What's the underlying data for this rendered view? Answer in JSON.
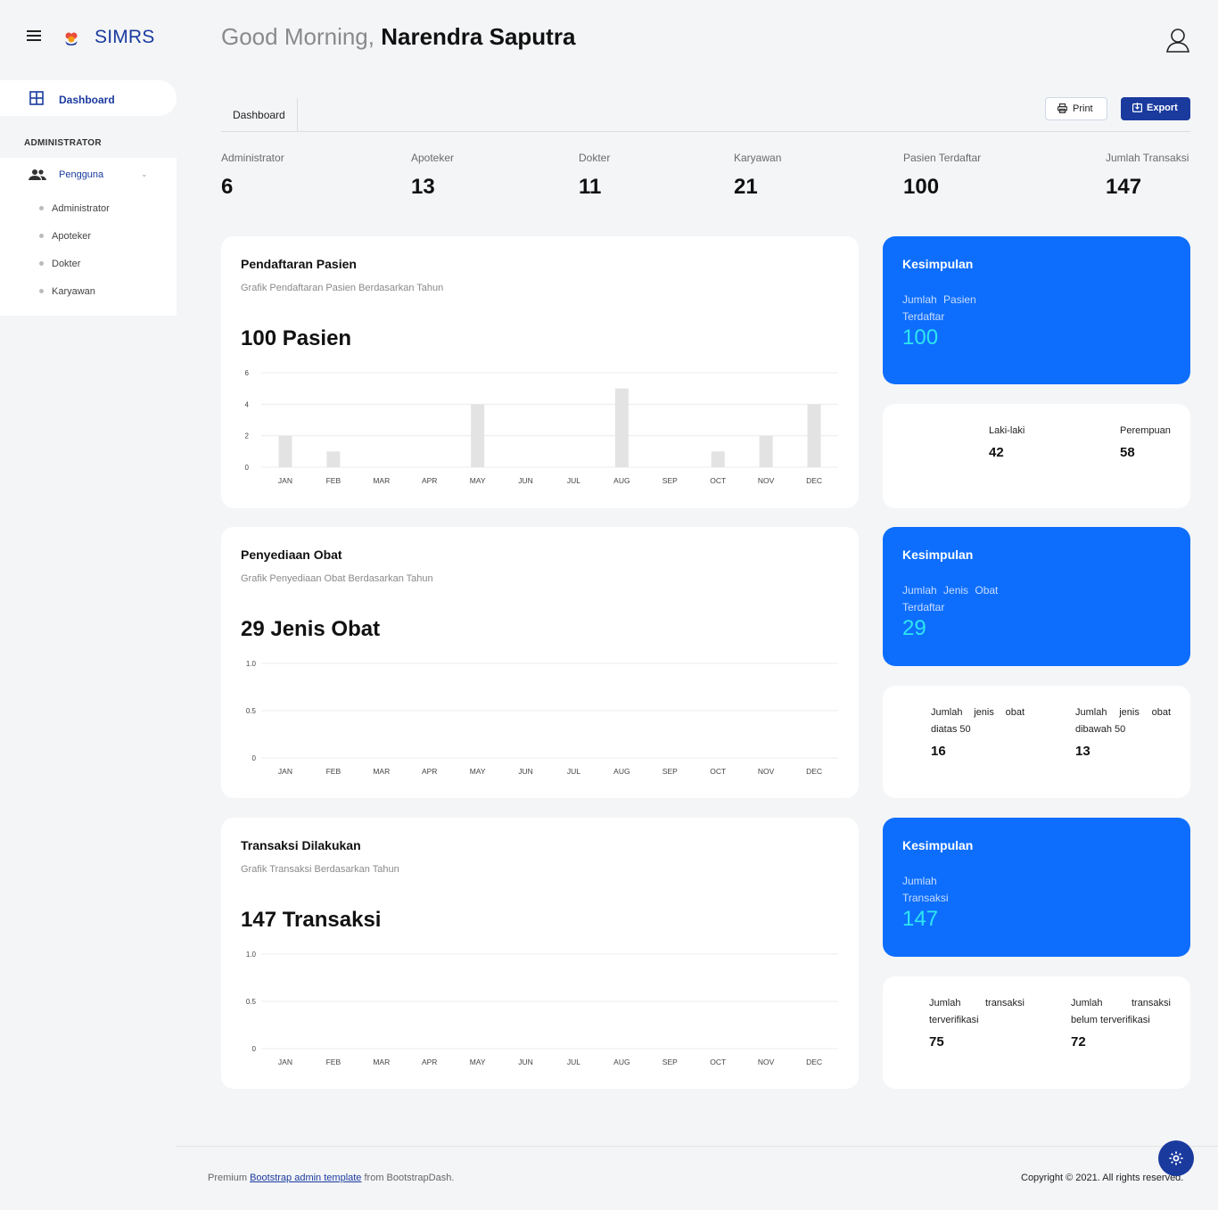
{
  "app": {
    "brand": "SIMRS"
  },
  "greeting": {
    "prefix": "Good Morning,",
    "name": "Narendra Saputra"
  },
  "sidebar": {
    "dashboard_label": "Dashboard",
    "section_label": "ADMINISTRATOR",
    "menu_label": "Pengguna",
    "items": [
      {
        "label": "Administrator"
      },
      {
        "label": "Apoteker"
      },
      {
        "label": "Dokter"
      },
      {
        "label": "Karyawan"
      }
    ]
  },
  "header": {
    "tab_label": "Dashboard",
    "print_label": "Print",
    "export_label": "Export"
  },
  "stats": [
    {
      "label": "Administrator",
      "value": "6"
    },
    {
      "label": "Apoteker",
      "value": "13"
    },
    {
      "label": "Dokter",
      "value": "11"
    },
    {
      "label": "Karyawan",
      "value": "21"
    },
    {
      "label": "Pasien Terdaftar",
      "value": "100"
    },
    {
      "label": "Jumlah Transaksi",
      "value": "147"
    }
  ],
  "cards": {
    "patients": {
      "title": "Pendaftaran Pasien",
      "subtitle": "Grafik Pendaftaran Pasien Berdasarkan Tahun",
      "big": "100 Pasien"
    },
    "drugs": {
      "title": "Penyediaan Obat",
      "subtitle": "Grafik Penyediaan Obat Berdasarkan Tahun",
      "big": "29 Jenis Obat"
    },
    "transactions": {
      "title": "Transaksi Dilakukan",
      "subtitle": "Grafik Transaksi Berdasarkan Tahun",
      "big": "147 Transaksi"
    }
  },
  "summaries": {
    "patients": {
      "title": "Kesimpulan",
      "label": "Jumlah Pasien Terdaftar",
      "value": "100"
    },
    "drugs": {
      "title": "Kesimpulan",
      "label": "Jumlah Jenis Obat Terdaftar",
      "value": "29"
    },
    "transactions": {
      "title": "Kesimpulan",
      "label": "Jumlah Transaksi",
      "value": "147"
    }
  },
  "details": {
    "patients": [
      {
        "label": "Laki-laki",
        "value": "42"
      },
      {
        "label": "Perempuan",
        "value": "58"
      }
    ],
    "drugs": [
      {
        "label": "Jumlah jenis obat diatas 50",
        "value": "16"
      },
      {
        "label": "Jumlah jenis obat dibawah 50",
        "value": "13"
      }
    ],
    "transactions": [
      {
        "label": "Jumlah transaksi terverifikasi",
        "value": "75"
      },
      {
        "label": "Jumlah transaksi belum terverifikasi",
        "value": "72"
      }
    ]
  },
  "footer": {
    "prefix": "Premium",
    "link": "Bootstrap admin template",
    "suffix": "from BootstrapDash.",
    "copyright": "Copyright © 2021. All rights reserved."
  },
  "colors": {
    "primary": "#1a3a9e",
    "summary_blue": "#0d6efd",
    "summary_value": "#2ee6f0",
    "bar": "#e3e3e3"
  },
  "chart_data": [
    {
      "type": "bar",
      "categories": [
        "JAN",
        "FEB",
        "MAR",
        "APR",
        "MAY",
        "JUN",
        "JUL",
        "AUG",
        "SEP",
        "OCT",
        "NOV",
        "DEC"
      ],
      "values": [
        2,
        1,
        0,
        0,
        4,
        0,
        0,
        5,
        0,
        1,
        2,
        4
      ],
      "yticks": [
        "0",
        "2",
        "4",
        "6"
      ],
      "ylim": [
        0,
        6
      ],
      "grid": true
    },
    {
      "type": "bar",
      "categories": [
        "JAN",
        "FEB",
        "MAR",
        "APR",
        "MAY",
        "JUN",
        "JUL",
        "AUG",
        "SEP",
        "OCT",
        "NOV",
        "DEC"
      ],
      "values": [
        0,
        0,
        0,
        0,
        0,
        0,
        0,
        0,
        0,
        0,
        0,
        0
      ],
      "yticks": [
        "0",
        "0.5",
        "1.0"
      ],
      "ylim": [
        0,
        1
      ],
      "grid": true
    },
    {
      "type": "bar",
      "categories": [
        "JAN",
        "FEB",
        "MAR",
        "APR",
        "MAY",
        "JUN",
        "JUL",
        "AUG",
        "SEP",
        "OCT",
        "NOV",
        "DEC"
      ],
      "values": [
        0,
        0,
        0,
        0,
        0,
        0,
        0,
        0,
        0,
        0,
        0,
        0
      ],
      "yticks": [
        "0",
        "0.5",
        "1.0"
      ],
      "ylim": [
        0,
        1
      ],
      "grid": true
    }
  ]
}
